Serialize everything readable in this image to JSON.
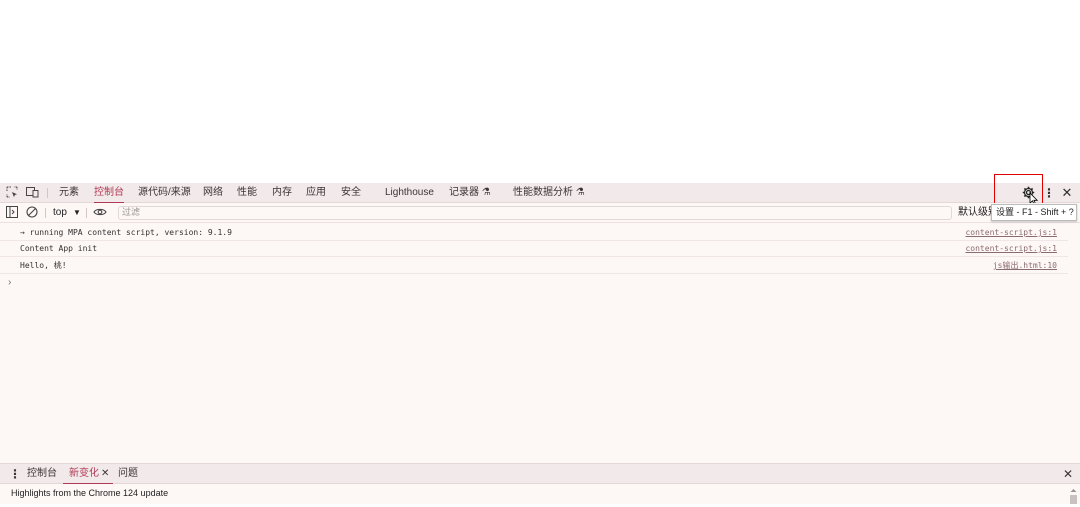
{
  "main_tabs": [
    {
      "label": "元素"
    },
    {
      "label": "控制台"
    },
    {
      "label": "源代码/来源"
    },
    {
      "label": "网络"
    },
    {
      "label": "性能"
    },
    {
      "label": "内存"
    },
    {
      "label": "应用"
    },
    {
      "label": "安全"
    },
    {
      "label": "Lighthouse"
    },
    {
      "label": "记录器 ⚗"
    },
    {
      "label": "性能数据分析 ⚗"
    }
  ],
  "active_tab": "控制台",
  "settings_tooltip": "设置 - F1 - Shift + ?",
  "toolbar": {
    "context": "top",
    "filter_placeholder": "过滤",
    "levels": "默认级别"
  },
  "messages": [
    {
      "text": "→ running MPA content script, version: 9.1.9",
      "source": "content-script.js:1"
    },
    {
      "text": "Content App init",
      "source": "content-script.js:1"
    },
    {
      "text": "Hello, 桃!",
      "source": "js输出.html:10"
    }
  ],
  "prompt": "›",
  "drawer": {
    "tabs": [
      {
        "label": "控制台"
      },
      {
        "label": "新变化"
      },
      {
        "label": "问题"
      }
    ],
    "active_tab": "新变化",
    "content": "Highlights from the Chrome 124 update"
  },
  "icons": {
    "inspect": "inspect-element-icon",
    "device": "device-toolbar-icon",
    "sidebar": "sidebar-toggle-icon",
    "clear": "clear-console-icon",
    "eye": "live-expression-eye-icon",
    "settings": "gear-icon",
    "more": "kebab-menu-icon",
    "close": "close-icon"
  },
  "colors": {
    "accent": "#b03a55",
    "highlight_box": "#e00000",
    "panel_bg": "#fdf7f5",
    "tabbar_bg": "#f2e9ea"
  }
}
